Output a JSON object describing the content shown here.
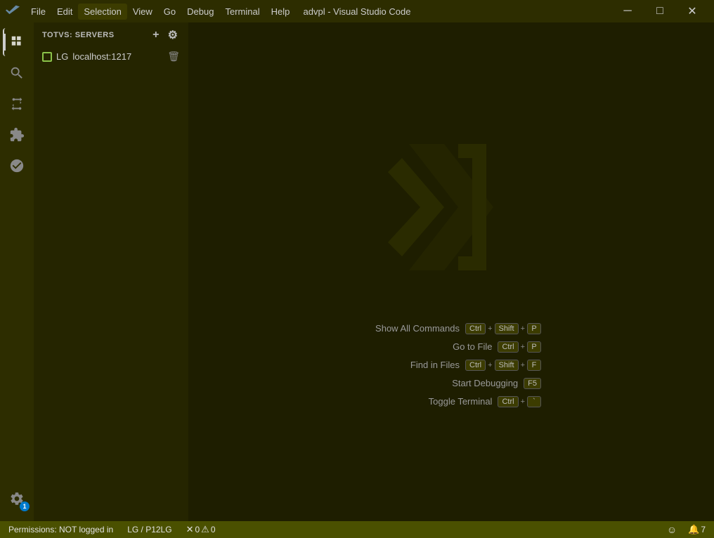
{
  "titlebar": {
    "title": "advpl - Visual Studio Code",
    "menu": [
      "File",
      "Edit",
      "Selection",
      "View",
      "Go",
      "Debug",
      "Terminal",
      "Help"
    ],
    "active_menu": "Selection",
    "minimize_label": "─",
    "restore_label": "□",
    "close_label": "✕"
  },
  "activity_bar": {
    "icons": [
      {
        "name": "explorer",
        "symbol": "⧉",
        "active": true
      },
      {
        "name": "search",
        "symbol": "🔍"
      },
      {
        "name": "source-control",
        "symbol": "⑂"
      },
      {
        "name": "extensions",
        "symbol": "⊞"
      },
      {
        "name": "remote-explorer",
        "symbol": "⊙"
      }
    ],
    "bottom_icons": [
      {
        "name": "settings",
        "symbol": "⚙",
        "badge": "1"
      }
    ]
  },
  "sidebar": {
    "header": "TOTVS: SERVERS",
    "add_label": "+",
    "settings_label": "⚙",
    "server": {
      "name": "LG",
      "host": "localhost:1217",
      "delete_label": "🗑"
    }
  },
  "editor": {
    "shortcuts": [
      {
        "label": "Show All Commands",
        "keys": [
          "Ctrl",
          "+",
          "Shift",
          "+",
          "P"
        ]
      },
      {
        "label": "Go to File",
        "keys": [
          "Ctrl",
          "+",
          "P"
        ]
      },
      {
        "label": "Find in Files",
        "keys": [
          "Ctrl",
          "+",
          "Shift",
          "+",
          "F"
        ]
      },
      {
        "label": "Start Debugging",
        "keys": [
          "F5"
        ]
      },
      {
        "label": "Toggle Terminal",
        "keys": [
          "Ctrl",
          "+",
          "`"
        ]
      }
    ]
  },
  "statusbar": {
    "permissions": "Permissions: NOT logged in",
    "server_info": "LG / P12LG",
    "errors": "0",
    "warnings": "0",
    "smiley": "☺",
    "notifications": "7"
  }
}
